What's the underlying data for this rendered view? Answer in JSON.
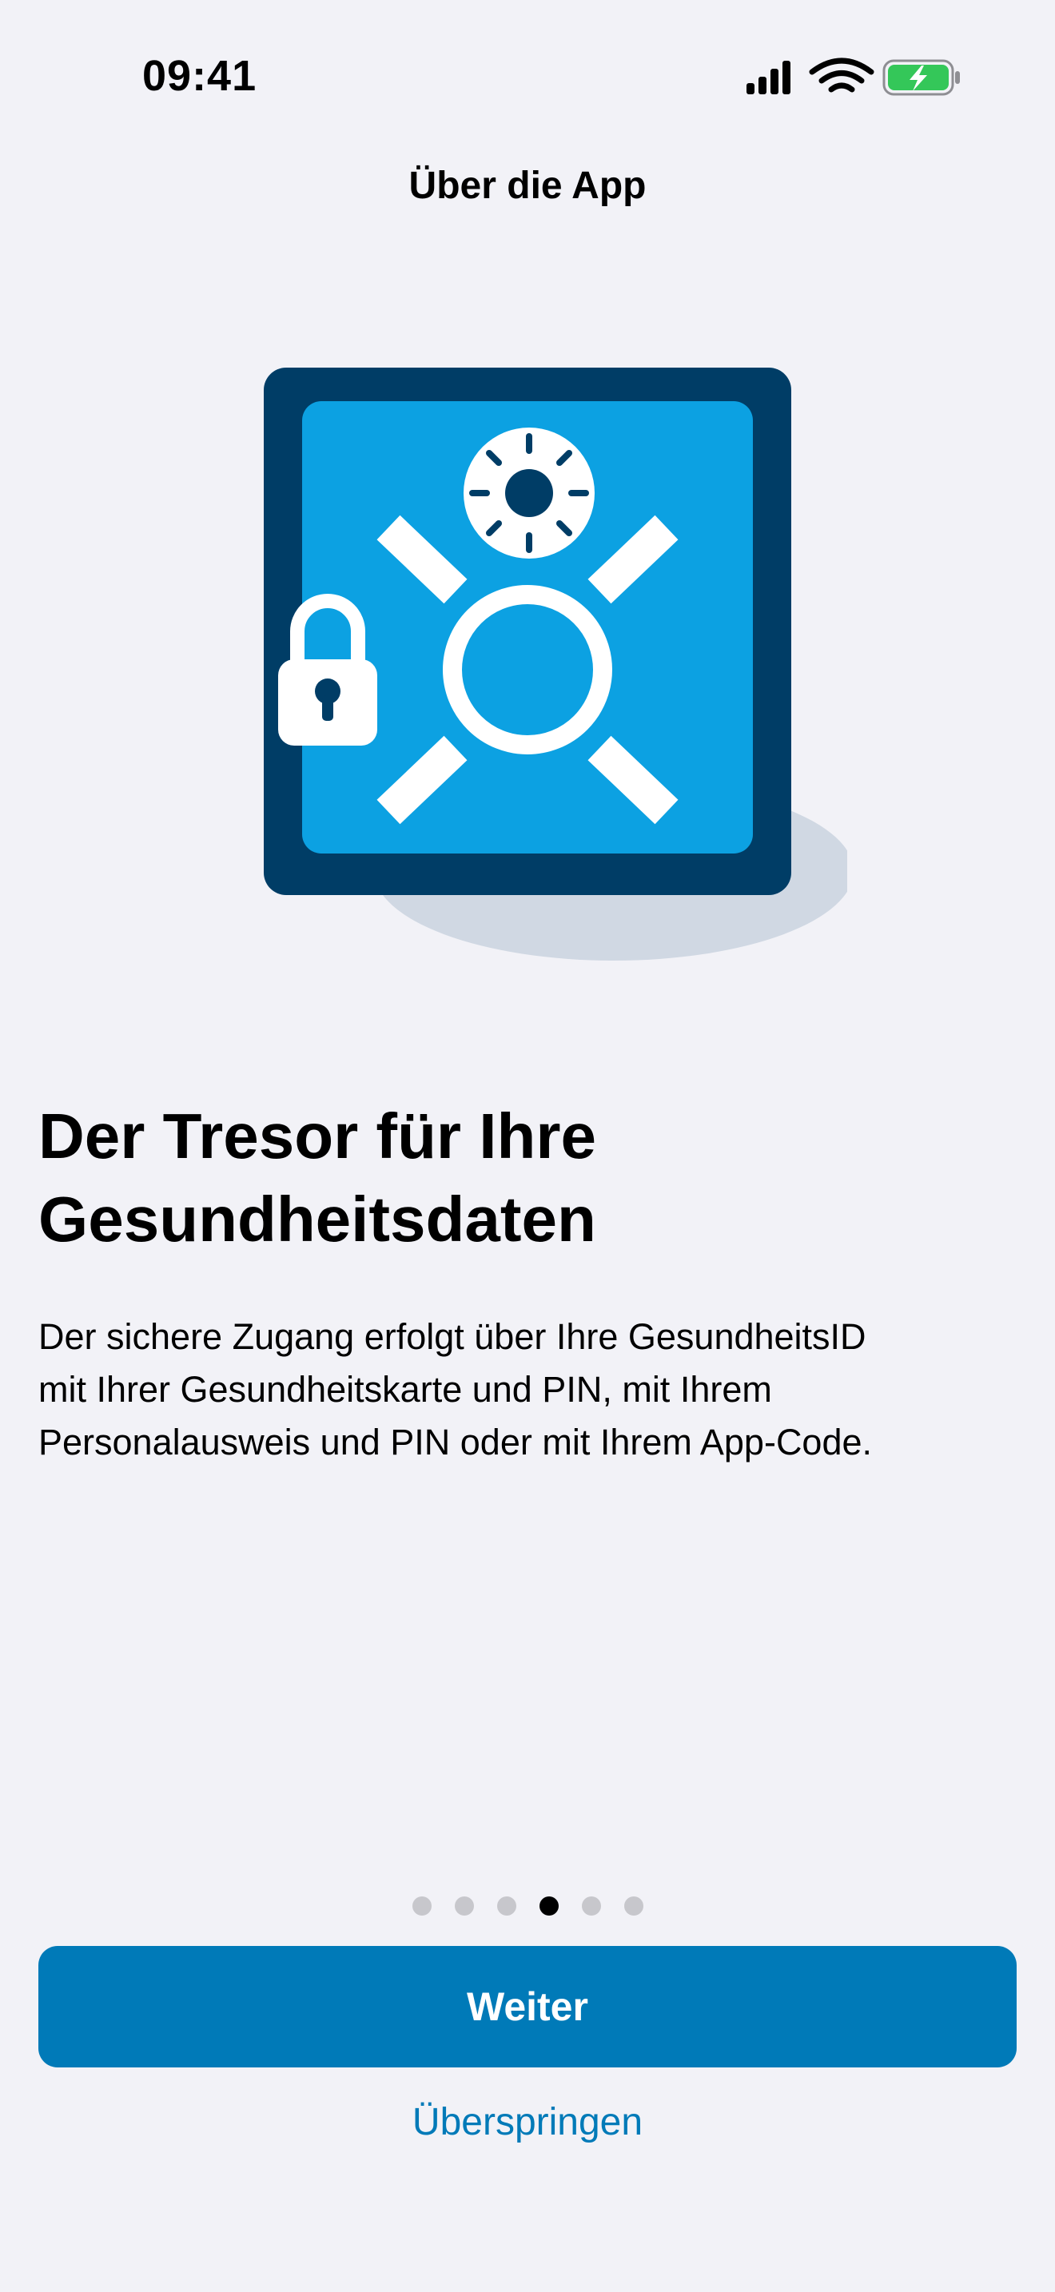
{
  "status_bar": {
    "time": "09:41",
    "icons": [
      "cellular-signal-icon",
      "wifi-icon",
      "battery-charging-icon"
    ],
    "battery_color": "#34c759"
  },
  "nav": {
    "title": "Über die App"
  },
  "illustration": {
    "icon": "safe-with-lock-icon",
    "colors": {
      "frame": "#003d66",
      "door": "#0ca1e2",
      "shadow": "#d0d8e3",
      "detail": "#ffffff"
    }
  },
  "content": {
    "headline_line1": "Der Tresor für Ihre",
    "headline_line2": "Gesundheitsdaten",
    "body_line1": "Der sichere Zugang erfolgt über Ihre GesundheitsID",
    "body_line2": "mit Ihrer Gesundheitskarte und PIN, mit Ihrem",
    "body_line3": "Personalausweis und PIN oder mit Ihrem App-Code."
  },
  "pagination": {
    "total": 6,
    "current": 4
  },
  "actions": {
    "primary_label": "Weiter",
    "skip_label": "Überspringen",
    "accent_color": "#007ab8"
  }
}
